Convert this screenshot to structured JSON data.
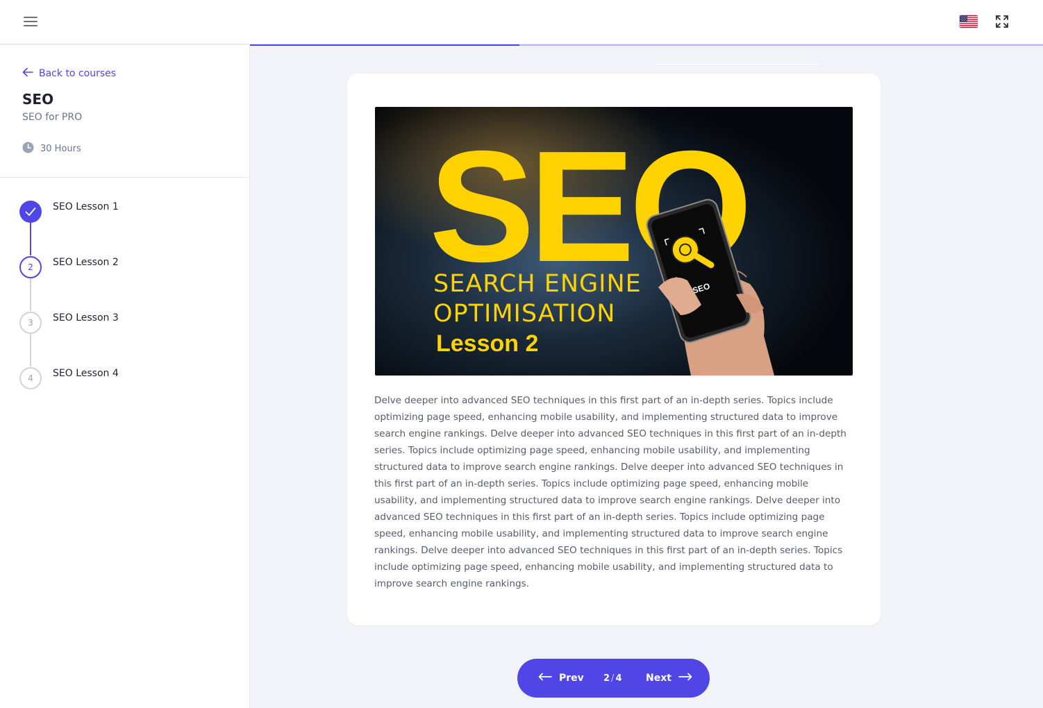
{
  "header": {
    "menu_icon": "hamburger-icon",
    "language_icon": "us-flag-icon",
    "fullscreen_icon": "expand-icon"
  },
  "progress": {
    "fraction": 0.34,
    "color": "#4f46e5",
    "track_color": "#b9b6f5"
  },
  "sidebar": {
    "back_label": "Back to courses",
    "course_title": "SEO",
    "course_subtitle": "SEO for PRO",
    "duration": "30 Hours",
    "lessons": [
      {
        "number": "1",
        "label": "SEO Lesson 1",
        "status": "completed"
      },
      {
        "number": "2",
        "label": "SEO Lesson 2",
        "status": "current"
      },
      {
        "number": "3",
        "label": "SEO Lesson 3",
        "status": "upcoming"
      },
      {
        "number": "4",
        "label": "SEO Lesson 4",
        "status": "upcoming"
      }
    ]
  },
  "lesson": {
    "image": {
      "headline": "SEO",
      "line1": "SEARCH ENGINE",
      "line2": "OPTIMISATION",
      "lesson_label": "Lesson 2",
      "phone_label": "SEO"
    },
    "body": "Delve deeper into advanced SEO techniques in this first part of an in-depth series. Topics include optimizing page speed, enhancing mobile usability, and implementing structured data to improve search engine rankings. Delve deeper into advanced SEO techniques in this first part of an in-depth series. Topics include optimizing page speed, enhancing mobile usability, and implementing structured data to improve search engine rankings. Delve deeper into advanced SEO techniques in this first part of an in-depth series. Topics include optimizing page speed, enhancing mobile usability, and implementing structured data to improve search engine rankings. Delve deeper into advanced SEO techniques in this first part of an in-depth series. Topics include optimizing page speed, enhancing mobile usability, and implementing structured data to improve search engine rankings. Delve deeper into advanced SEO techniques in this first part of an in-depth series. Topics include optimizing page speed, enhancing mobile usability, and implementing structured data to improve search engine rankings."
  },
  "pager": {
    "prev_label": "Prev",
    "next_label": "Next",
    "current": "2",
    "total": "4",
    "separator": "/"
  },
  "colors": {
    "accent": "#4f46e5",
    "image_yellow": "#ffd200",
    "page_bg": "#f1f3f8"
  }
}
